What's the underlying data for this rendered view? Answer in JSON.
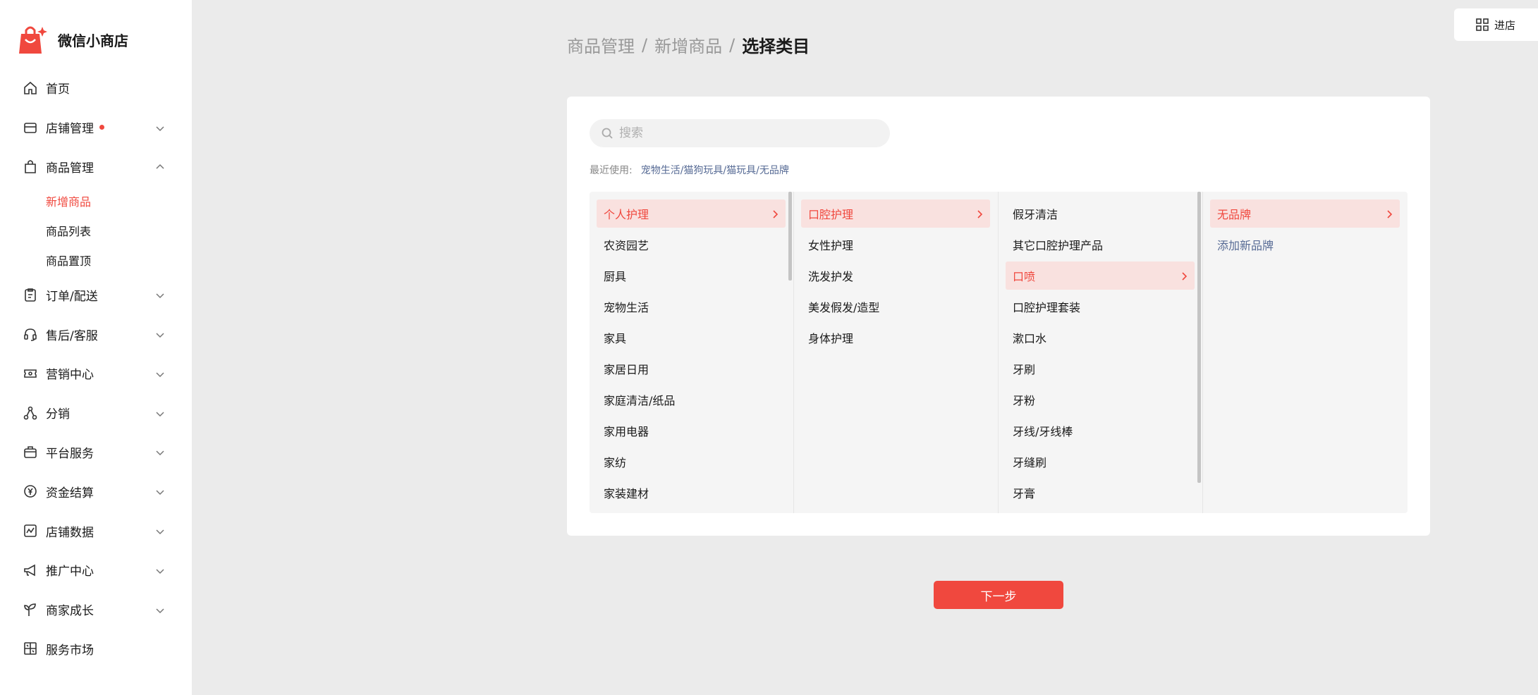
{
  "brand": {
    "name": "微信小商店",
    "logo_icon": "shopping-bag-logo-icon",
    "accent": "#f0483e"
  },
  "top_right": {
    "store_label": "进店",
    "icon": "qrcode-icon"
  },
  "sidebar": {
    "items": [
      {
        "label": "首页",
        "icon": "home-icon"
      },
      {
        "label": "店铺管理",
        "icon": "store-icon",
        "has_dot": true
      },
      {
        "label": "商品管理",
        "icon": "bag-icon",
        "expanded": true,
        "children": [
          {
            "label": "新增商品",
            "active": true
          },
          {
            "label": "商品列表"
          },
          {
            "label": "商品置顶"
          }
        ]
      },
      {
        "label": "订单/配送",
        "icon": "clipboard-icon"
      },
      {
        "label": "售后/客服",
        "icon": "headset-icon"
      },
      {
        "label": "营销中心",
        "icon": "ticket-icon"
      },
      {
        "label": "分销",
        "icon": "share-icon"
      },
      {
        "label": "平台服务",
        "icon": "briefcase-icon"
      },
      {
        "label": "资金结算",
        "icon": "yen-icon"
      },
      {
        "label": "店铺数据",
        "icon": "chart-icon"
      },
      {
        "label": "推广中心",
        "icon": "megaphone-icon"
      },
      {
        "label": "商家成长",
        "icon": "sprout-icon"
      },
      {
        "label": "服务市场",
        "icon": "market-icon"
      }
    ]
  },
  "breadcrumb": {
    "level1": "商品管理",
    "level2": "新增商品",
    "current": "选择类目",
    "separator": "/"
  },
  "search": {
    "placeholder": "搜索",
    "value": ""
  },
  "recent": {
    "label": "最近使用:",
    "path": "宠物生活/猫狗玩具/猫玩具/无品牌"
  },
  "columns": [
    {
      "items": [
        "个人护理",
        "农资园艺",
        "厨具",
        "宠物生活",
        "家具",
        "家居日用",
        "家庭清洁/纸品",
        "家用电器",
        "家纺",
        "家装建材"
      ],
      "selected": 0
    },
    {
      "items": [
        "口腔护理",
        "女性护理",
        "洗发护发",
        "美发假发/造型",
        "身体护理"
      ],
      "selected": 0
    },
    {
      "items": [
        "假牙清洁",
        "其它口腔护理产品",
        "口喷",
        "口腔护理套装",
        "漱口水",
        "牙刷",
        "牙粉",
        "牙线/牙线棒",
        "牙缝刷",
        "牙膏"
      ],
      "selected": 2
    },
    {
      "items": [
        "无品牌"
      ],
      "selected": 0,
      "add_link": "添加新品牌"
    }
  ],
  "next_button": "下一步"
}
